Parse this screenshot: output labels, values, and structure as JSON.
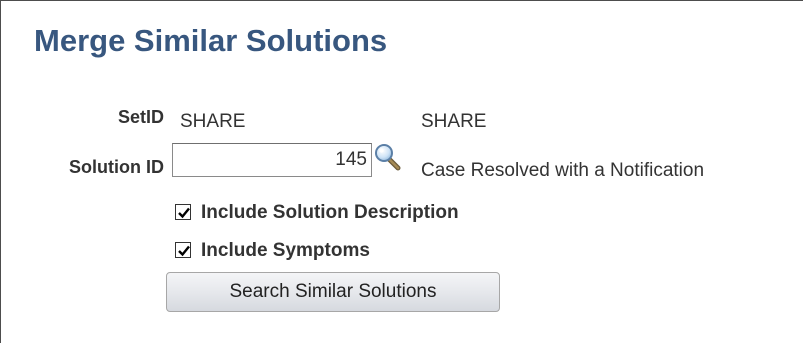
{
  "page": {
    "title": "Merge Similar Solutions"
  },
  "setid": {
    "label": "SetID",
    "value": "SHARE",
    "description": "SHARE"
  },
  "solution": {
    "label": "Solution ID",
    "value": "145",
    "description": "Case Resolved with a Notification",
    "lookup_icon": "magnifier-lookup-icon"
  },
  "options": {
    "include_description": {
      "label": "Include Solution Description",
      "checked": true
    },
    "include_symptoms": {
      "label": "Include Symptoms",
      "checked": true
    }
  },
  "actions": {
    "search_label": "Search Similar Solutions"
  },
  "colors": {
    "title": "#38577f",
    "label": "#333333",
    "button_top": "#f4f5f7",
    "button_bottom": "#d6d9df"
  }
}
